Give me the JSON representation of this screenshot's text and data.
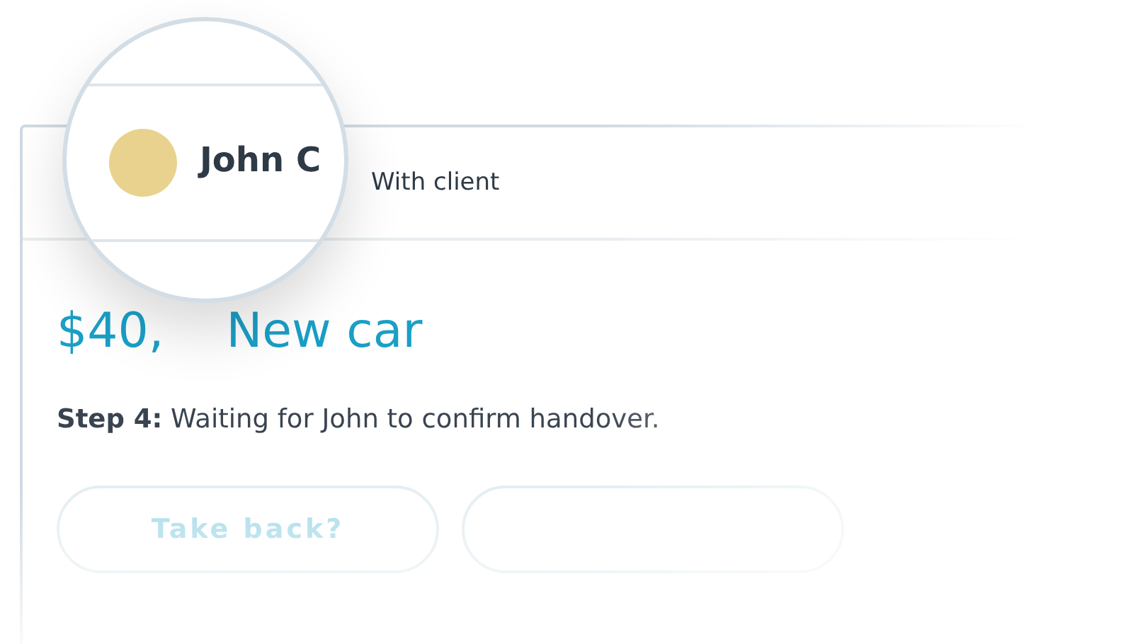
{
  "card": {
    "status": "With client",
    "lens": {
      "name": "John C"
    },
    "amount": {
      "before_lens": "$40,",
      "after_lens": "New car"
    },
    "step": "**Step 4:** Waiting for John to confirm handover.",
    "buttons": [
      {
        "kind": "labelled",
        "label": "Take back?"
      },
      {
        "kind": "blank"
      }
    ]
  }
}
